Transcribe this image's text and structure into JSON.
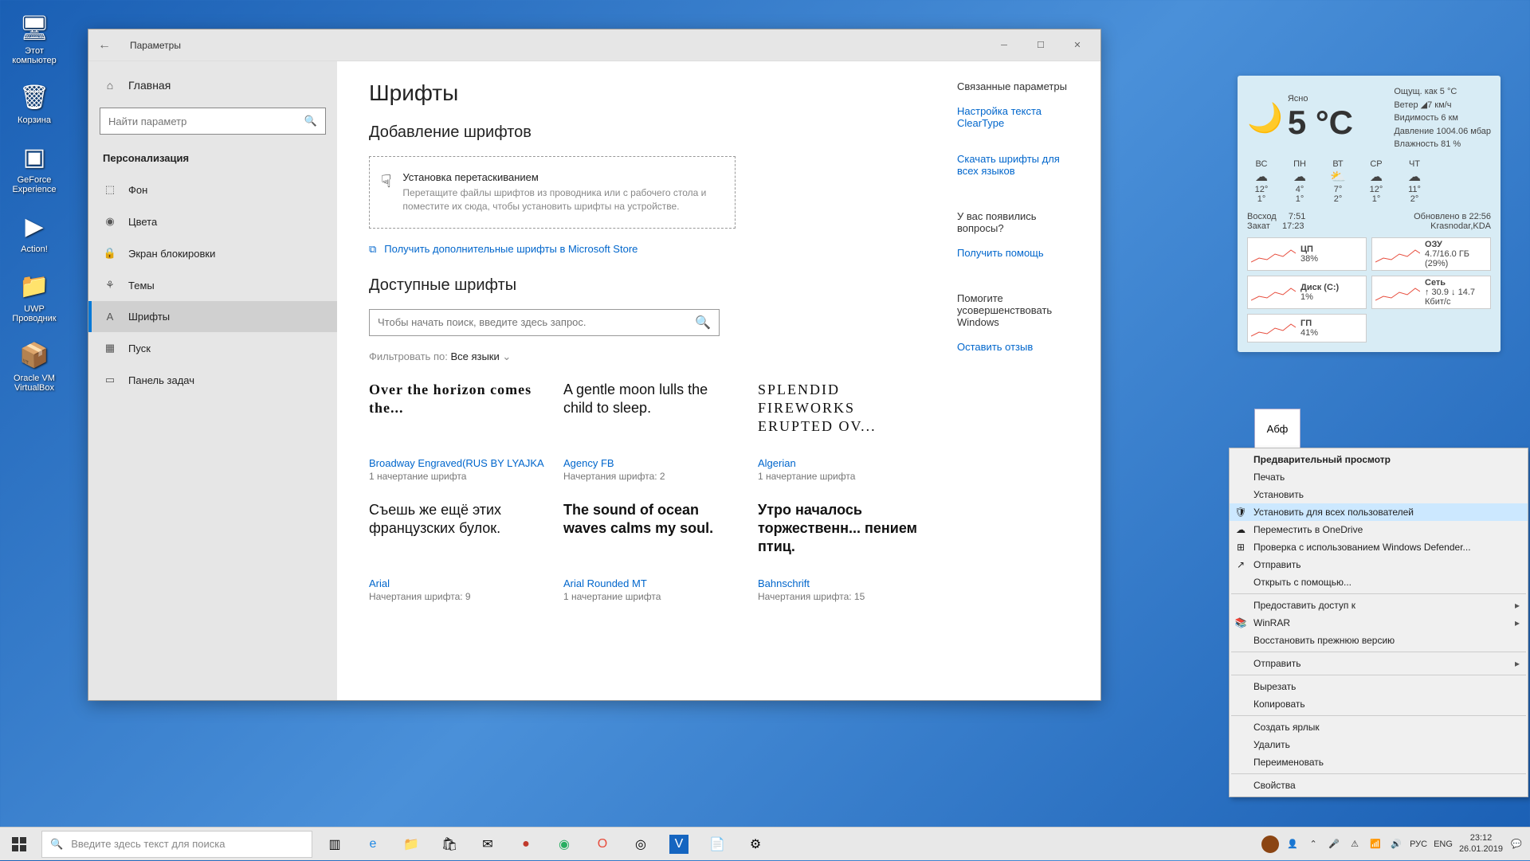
{
  "desktop": {
    "icons": [
      {
        "label": "Этот компьютер"
      },
      {
        "label": "Корзина"
      },
      {
        "label": "GeForce Experience"
      },
      {
        "label": "Action!"
      },
      {
        "label": "UWP Проводник"
      },
      {
        "label": "Oracle VM VirtualBox"
      }
    ]
  },
  "window": {
    "title": "Параметры",
    "sidebar": {
      "home": "Главная",
      "search_placeholder": "Найти параметр",
      "section": "Персонализация",
      "items": [
        "Фон",
        "Цвета",
        "Экран блокировки",
        "Темы",
        "Шрифты",
        "Пуск",
        "Панель задач"
      ],
      "active_index": 4
    },
    "main": {
      "heading": "Шрифты",
      "add_heading": "Добавление шрифтов",
      "drop_title": "Установка перетаскиванием",
      "drop_sub": "Перетащите файлы шрифтов из проводника или с рабочего стола и поместите их сюда, чтобы установить шрифты на устройстве.",
      "store_link": "Получить дополнительные шрифты в Microsoft Store",
      "avail_heading": "Доступные шрифты",
      "font_search_placeholder": "Чтобы начать поиск, введите здесь запрос.",
      "filter_label": "Фильтровать по:",
      "filter_value": "Все языки",
      "fonts": [
        {
          "preview": "Over the horizon comes the...",
          "name": "Broadway Engraved(RUS BY LYAJKA",
          "variants": "1 начертание шрифта",
          "style": "font-family:serif;font-weight:700;letter-spacing:1px;"
        },
        {
          "preview": "A gentle moon lulls the child to sleep.",
          "name": "Agency FB",
          "variants": "Начертания шрифта: 2",
          "style": "font-family:sans-serif;font-stretch:condensed;"
        },
        {
          "preview": "SPLENDID FIREWORKS ERUPTED OV...",
          "name": "Algerian",
          "variants": "1 начертание шрифта",
          "style": "font-family:serif;letter-spacing:2px;"
        },
        {
          "preview": "Съешь же ещё этих французских булок.",
          "name": "Arial",
          "variants": "Начертания шрифта: 9",
          "style": "font-family:Arial;"
        },
        {
          "preview": "The sound of ocean waves calms my soul.",
          "name": "Arial Rounded MT",
          "variants": "1 начертание шрифта",
          "style": "font-family:Arial;font-weight:700;"
        },
        {
          "preview": "Утро началось торжественн... пением птиц.",
          "name": "Bahnschrift",
          "variants": "Начертания шрифта: 15",
          "style": "font-family:sans-serif;font-weight:700;"
        }
      ]
    },
    "right": {
      "related_heading": "Связанные параметры",
      "links": [
        "Настройка текста ClearType",
        "Скачать шрифты для всех языков"
      ],
      "questions_heading": "У вас появились вопросы?",
      "help_link": "Получить помощь",
      "improve_heading": "Помогите усовершенствовать Windows",
      "feedback_link": "Оставить отзыв"
    }
  },
  "weather": {
    "condition": "Ясно",
    "temp": "5 °C",
    "feels_label": "Ощущ. как",
    "feels": "5 °C",
    "wind_label": "Ветер",
    "wind": "7 км/ч",
    "vis_label": "Видимость",
    "vis": "6 км",
    "press_label": "Давление",
    "press": "1004.06 мбар",
    "hum_label": "Влажность",
    "hum": "81 %",
    "days": [
      "ВС",
      "ПН",
      "ВТ",
      "СР",
      "ЧТ"
    ],
    "hi": [
      "12°",
      "4°",
      "7°",
      "12°",
      "11°"
    ],
    "lo": [
      "1°",
      "1°",
      "2°",
      "1°",
      "2°"
    ],
    "sunrise_label": "Восход",
    "sunrise": "7:51",
    "sunset_label": "Закат",
    "sunset": "17:23",
    "updated_label": "Обновлено в",
    "updated": "22:56",
    "city": "Krasnodar,KDA",
    "meters": [
      {
        "name": "ЦП",
        "val": "38%"
      },
      {
        "name": "ОЗУ",
        "val": "4.7/16.0 ГБ (29%)"
      },
      {
        "name": "Диск (C:)",
        "val": "1%"
      },
      {
        "name": "Сеть",
        "val": "↑ 30.9 ↓ 14.7 Кбит/с"
      },
      {
        "name": "ГП",
        "val": "41%"
      }
    ]
  },
  "font_file": {
    "label": "Абф"
  },
  "context_menu": {
    "items": [
      {
        "label": "Предварительный просмотр",
        "bold": true
      },
      {
        "label": "Печать"
      },
      {
        "label": "Установить"
      },
      {
        "label": "Установить для всех пользователей",
        "icon": "🛡",
        "hover": true
      },
      {
        "label": "Переместить в OneDrive",
        "icon": "☁"
      },
      {
        "label": "Проверка с использованием Windows Defender...",
        "icon": "⊞"
      },
      {
        "label": "Отправить",
        "icon": "↗"
      },
      {
        "label": "Открыть с помощью..."
      },
      {
        "sep": true
      },
      {
        "label": "Предоставить доступ к",
        "arrow": true
      },
      {
        "label": "WinRAR",
        "icon": "📚",
        "arrow": true
      },
      {
        "label": "Восстановить прежнюю версию"
      },
      {
        "sep": true
      },
      {
        "label": "Отправить",
        "arrow": true
      },
      {
        "sep": true
      },
      {
        "label": "Вырезать"
      },
      {
        "label": "Копировать"
      },
      {
        "sep": true
      },
      {
        "label": "Создать ярлык"
      },
      {
        "label": "Удалить"
      },
      {
        "label": "Переименовать"
      },
      {
        "sep": true
      },
      {
        "label": "Свойства"
      }
    ]
  },
  "taskbar": {
    "search_placeholder": "Введите здесь текст для поиска",
    "lang": "РУС",
    "kbd": "ENG",
    "time": "23:12",
    "date": "26.01.2019"
  }
}
